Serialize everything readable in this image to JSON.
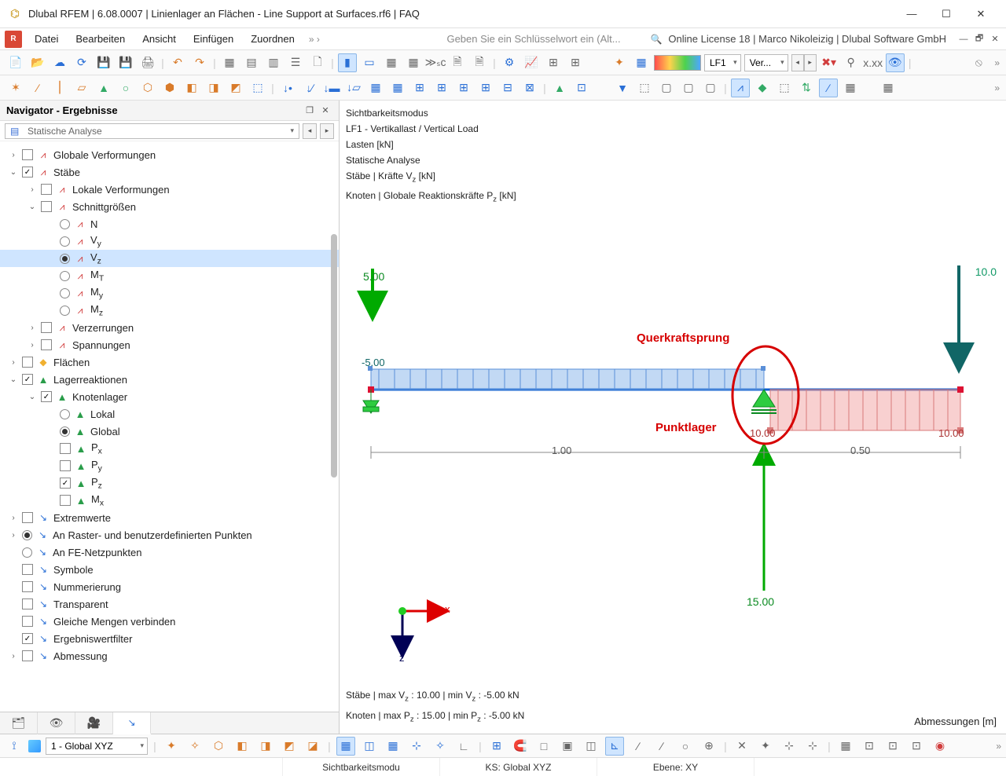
{
  "window": {
    "title": "Dlubal RFEM | 6.08.0007 | Linienlager an Flächen - Line Support at Surfaces.rf6 | FAQ"
  },
  "menu": {
    "items": [
      "Datei",
      "Bearbeiten",
      "Ansicht",
      "Einfügen",
      "Zuordnen"
    ],
    "overflow": "» ›",
    "search_placeholder": "Geben Sie ein Schlüsselwort ein (Alt...",
    "license": "Online License 18 | Marco Nikoleizig | Dlubal Software GmbH"
  },
  "toolbar_combos": {
    "loadcase_short": "LF1",
    "loadcase_name": "Ver..."
  },
  "navigator": {
    "title": "Navigator - Ergebnisse",
    "analysis_combo": "Statische Analyse",
    "rows": [
      {
        "d": 0,
        "tw": "›",
        "cb": 0,
        "ic": "beam",
        "t": "Globale Verformungen"
      },
      {
        "d": 0,
        "tw": "v",
        "cb": 1,
        "ic": "beam",
        "t": "Stäbe"
      },
      {
        "d": 1,
        "tw": "›",
        "cb": 0,
        "ic": "beam",
        "t": "Lokale Verformungen"
      },
      {
        "d": 1,
        "tw": "v",
        "cb": 0,
        "ic": "beam",
        "t": "Schnittgrößen"
      },
      {
        "d": 2,
        "radio": 0,
        "ic": "beam",
        "t": "N"
      },
      {
        "d": 2,
        "radio": 0,
        "ic": "beam",
        "t": "Vy"
      },
      {
        "d": 2,
        "radio": 1,
        "ic": "beam",
        "t": "Vz",
        "sel": 1
      },
      {
        "d": 2,
        "radio": 0,
        "ic": "beam",
        "t": "MT"
      },
      {
        "d": 2,
        "radio": 0,
        "ic": "beam",
        "t": "My"
      },
      {
        "d": 2,
        "radio": 0,
        "ic": "beam",
        "t": "Mz"
      },
      {
        "d": 1,
        "tw": "›",
        "cb": 0,
        "ic": "beam",
        "t": "Verzerrungen"
      },
      {
        "d": 1,
        "tw": "›",
        "cb": 0,
        "ic": "beam",
        "t": "Spannungen"
      },
      {
        "d": 0,
        "tw": "›",
        "cb": 0,
        "ic": "surf",
        "t": "Flächen"
      },
      {
        "d": 0,
        "tw": "v",
        "cb": 1,
        "ic": "react",
        "t": "Lagerreaktionen"
      },
      {
        "d": 1,
        "tw": "v",
        "cb": 1,
        "ic": "node",
        "t": "Knotenlager"
      },
      {
        "d": 2,
        "radio": 0,
        "ic": "node",
        "t": "Lokal"
      },
      {
        "d": 2,
        "radio": 1,
        "ic": "node",
        "t": "Global"
      },
      {
        "d": 2,
        "cb": 0,
        "ic": "node",
        "t": "Px"
      },
      {
        "d": 2,
        "cb": 0,
        "ic": "node",
        "t": "Py"
      },
      {
        "d": 2,
        "cb": 1,
        "ic": "node",
        "t": "Pz"
      },
      {
        "d": 2,
        "cb": 0,
        "ic": "node",
        "t": "Mx"
      },
      {
        "d": 0,
        "tw": "›",
        "cb": 0,
        "ic": "res",
        "t": "Extremwerte"
      },
      {
        "d": 0,
        "tw": "›",
        "radio": 1,
        "ic": "res",
        "t": "An Raster- und benutzerdefinierten Punkten"
      },
      {
        "d": 0,
        "tw": "",
        "radio": 0,
        "ic": "res",
        "t": "An FE-Netzpunkten"
      },
      {
        "d": 0,
        "tw": "",
        "cb": 0,
        "ic": "res",
        "t": "Symbole"
      },
      {
        "d": 0,
        "tw": "",
        "cb": 0,
        "ic": "res",
        "t": "Nummerierung"
      },
      {
        "d": 0,
        "tw": "",
        "cb": 0,
        "ic": "res",
        "t": "Transparent"
      },
      {
        "d": 0,
        "tw": "",
        "cb": 0,
        "ic": "res",
        "t": "Gleiche Mengen verbinden"
      },
      {
        "d": 0,
        "tw": "",
        "cb": 1,
        "ic": "res",
        "t": "Ergebniswertfilter"
      },
      {
        "d": 0,
        "tw": "›",
        "cb": 0,
        "ic": "res",
        "t": "Abmessung"
      }
    ]
  },
  "viewport_info": {
    "lines": [
      "Sichtbarkeitsmodus",
      "LF1 - Vertikallast / Vertical Load",
      "Lasten [kN]",
      "Statische Analyse"
    ],
    "line_forces": "Stäbe | Kräfte V",
    "line_forces_sub": "z",
    "line_forces_unit": " [kN]",
    "line_react": "Knoten | Globale Reaktionskräfte P",
    "line_react_sub": "z",
    "line_react_unit": " [kN]",
    "bottom1": "Stäbe | max Vz : 10.00 | min Vz : -5.00 kN",
    "bottom2": "Knoten | max Pz : 15.00 | min Pz : -5.00 kN",
    "right_bottom": "Abmessungen [m]"
  },
  "graphics": {
    "load_left": "5.00",
    "load_right": "10.0",
    "shear_left": "-5.00",
    "shear_right_top": "10.00",
    "shear_right_bot": "10.00",
    "reaction_mid": "15.00",
    "dim_left": "1.00",
    "dim_right": "0.50",
    "axis_x": "x",
    "axis_z": "z",
    "annot_top": "Querkraftsprung",
    "annot_bot": "Punktlager"
  },
  "chart_data": {
    "type": "bar",
    "description": "Beam shear force Vz diagram with point reaction",
    "beam_length_m": 1.5,
    "span_left_m": 1.0,
    "span_right_m": 0.5,
    "point_loads_kN": [
      {
        "x_m": 0.0,
        "P": 5.0
      },
      {
        "x_m": 1.5,
        "P": 10.0
      }
    ],
    "shear_Vz_kN": [
      {
        "x_m": 0.0,
        "Vz": -5.0
      },
      {
        "x_m": 1.0,
        "Vz_left": -5.0,
        "Vz_right": 10.0
      },
      {
        "x_m": 1.5,
        "Vz": 10.0
      }
    ],
    "nodal_reactions_Pz_kN": [
      {
        "x_m": 1.0,
        "Pz": 15.0
      }
    ],
    "annotations": [
      "Querkraftsprung",
      "Punktlager"
    ]
  },
  "bottom_bar": {
    "cs_combo": "1 - Global XYZ"
  },
  "status": {
    "c1": "Sichtbarkeitsmodu",
    "c2": "KS: Global XYZ",
    "c3": "Ebene: XY"
  }
}
